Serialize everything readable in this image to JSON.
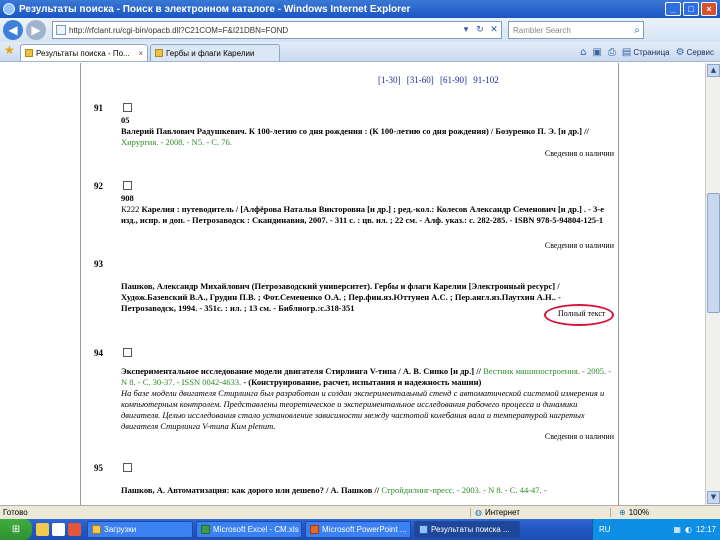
{
  "window": {
    "title": "Результаты поиска - Поиск в электронном каталоге - Windows Internet Explorer",
    "controls": [
      "_",
      "□",
      "×"
    ]
  },
  "address": {
    "url": "http://rfclant.ru/cgi-bin/opacb.dll?C21COM=F&I21DBN=FOND",
    "search_placeholder": "Rambler Search"
  },
  "tabs": [
    {
      "label": "Результаты поиска - По...",
      "active": true
    },
    {
      "label": "Гербы и флаги Карелии",
      "active": false
    }
  ],
  "commands": [
    {
      "label": "",
      "icon": "home-icon",
      "glyph": "⌂"
    },
    {
      "label": "",
      "icon": "feeds-icon",
      "glyph": "▣"
    },
    {
      "label": "",
      "icon": "print-icon",
      "glyph": "⎙"
    },
    {
      "label": "Страница",
      "icon": "page-icon",
      "glyph": "▤"
    },
    {
      "label": "Сервис",
      "icon": "tools-icon",
      "glyph": "⚙"
    }
  ],
  "pager": [
    "[1-30]",
    "[31-60]",
    "[61-90]",
    "91-102"
  ],
  "records": [
    {
      "num": "91",
      "code": "05",
      "title": "Валерий Павлович Радушкевич. К 100-летию со дня рождения : (К 100-летию со дня рождения) / Бозуренко П. Э. [и др.] //",
      "source": "Хирургия. - 2008. - N5. - С. 76.",
      "availability": "Сведения о наличии"
    },
    {
      "num": "92",
      "code": "908",
      "subcode": "К222",
      "title": "Карелия : путеводитель / [Алфёрова Наталья Викторовна [и др.] ; ред.-кол.: Колесов Александр Семенович [и др.] . - 3-е изд., испр. и доп. - Петрозаводск : Скандинавия, 2007. - 311 с. : цв. ил. ; 22 см. - Алф. указ.: с. 282-285. - ISBN 978-5-94804-125-1",
      "availability": "Сведения о наличии"
    },
    {
      "num": "93",
      "title": "Пашков, Александр Михайлович (Петрозаводский университет). Гербы и флаги Карелии [Электронный ресурс] / Худож.Базевский В.А., Грудин П.В. ; Фот.Семененко О.А. ; Пер.фин.яз.Юттунен А.С. ; Пер.англ.яз.Паутхин А.Н.. - Петрозаводск, 1994. - 351с. : ил. ; 13 см. - Библиогр.:с.318-351",
      "fulltext": "Полный текст"
    },
    {
      "num": "94",
      "title": "Экспериментальное исследование модели двигателя Стирлинга V-типа / А. В. Сипко [и др.] //",
      "source": "Вестник машиностроения. - 2005. - N 8. - С. 30-37. - ISSN 0042-4633.",
      "tail": "- (Конструирование, расчет, испытания и надежность машин)",
      "abstract": "На базе модели двигателя Стирлинга был разработан и создан экспериментальный стенд с автоматической системой измерения и компьютерным контролем. Представлены теоретическое и экспериментальное исследования рабочего процесса и динамики двигателя. Целью исследования стало установление зависимости между частотой колебания вала и температурой нагретых двигателя Стирлинга V-типа Ким plenum.",
      "availability": "Сведения о наличии"
    },
    {
      "num": "95",
      "title": "Пашков, А. Автоматизация: как дорого или дешево? / А. Пашков //",
      "source": "Стройдилинг-пресс. - 2003. - N 8. - С. 44-47. -"
    }
  ],
  "status": {
    "ready": "Готово",
    "zone": "Интернет",
    "zoom": "100%"
  },
  "taskbar": {
    "start_glyph": "⊞",
    "quicklaunch": [
      {
        "icon": "desktop-icon",
        "color": "#f2c94c"
      },
      {
        "icon": "ie-icon",
        "color": "#ffffff"
      },
      {
        "icon": "media-icon",
        "color": "#e3563b"
      }
    ],
    "buttons": [
      {
        "label": "Загрузки",
        "active": false
      },
      {
        "label": "Microsoft Excel - СМ.xls",
        "active": false
      },
      {
        "label": "Microsoft PowerPoint ...",
        "active": false
      },
      {
        "label": "Результаты поиска ...",
        "active": true
      }
    ],
    "lang": "RU",
    "clock": "12:17"
  }
}
